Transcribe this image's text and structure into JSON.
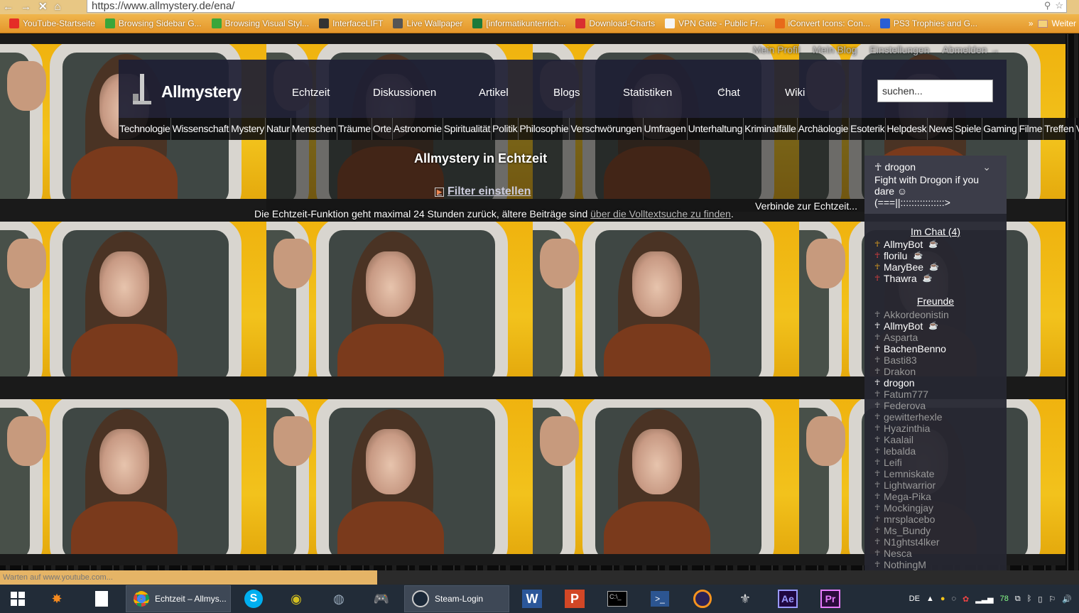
{
  "browser": {
    "url": "https://www.allmystery.de/ena/",
    "bookmarks": [
      {
        "label": "YouTube-Startseite",
        "icon": "youtube-icon",
        "color": "#e52d27"
      },
      {
        "label": "Browsing Sidebar G...",
        "icon": "leaf-icon",
        "color": "#3aa63a"
      },
      {
        "label": "Browsing Visual Styl...",
        "icon": "leaf-icon",
        "color": "#3aa63a"
      },
      {
        "label": "InterfaceLIFT",
        "icon": "ifl-icon",
        "color": "#333333"
      },
      {
        "label": "Live Wallpaper",
        "icon": "globe-icon",
        "color": "#555555"
      },
      {
        "label": "[informatikunterrich...",
        "icon": "iz-icon",
        "color": "#1c7a3a"
      },
      {
        "label": "Download-Charts",
        "icon": "chart-icon",
        "color": "#d93030"
      },
      {
        "label": "VPN Gate - Public Fr...",
        "icon": "page-icon",
        "color": "#f5f5f5"
      },
      {
        "label": "iConvert Icons: Con...",
        "icon": "convert-icon",
        "color": "#e86a1a"
      },
      {
        "label": "PS3 Trophies and G...",
        "icon": "ps3-icon",
        "color": "#2a5ed6"
      }
    ],
    "bookmarks_more": "»",
    "bookmarks_folder": "Weiter",
    "status": "Warten auf www.youtube.com..."
  },
  "site": {
    "top_links": [
      "Mein Profil",
      "Mein Blog",
      "Einstellungen",
      "Abmelden"
    ],
    "logout_arrow": "→",
    "logo": "Allmystery",
    "nav": [
      "Echtzeit",
      "Diskussionen",
      "Artikel",
      "Blogs",
      "Statistiken",
      "Chat",
      "Wiki"
    ],
    "chat_badge": "4",
    "search_placeholder": "suchen...",
    "categories": [
      "Technologie",
      "Wissenschaft",
      "Mystery",
      "Natur",
      "Menschen",
      "Träume",
      "Orte",
      "Astronomie",
      "Spiritualität",
      "Politik",
      "Philosophie",
      "Verschwörungen",
      "Umfragen",
      "Unterhaltung",
      "Kriminalfälle",
      "Archäologie",
      "Esoterik",
      "Helpdesk",
      "News",
      "Spiele",
      "Gaming",
      "Filme",
      "Treffen",
      "Verbesserungen"
    ]
  },
  "content": {
    "title": "Allmystery in Echtzeit",
    "filter": "Filter einstellen",
    "connecting": "Verbinde zur Echtzeit...",
    "info_text": "Die Echtzeit-Funktion geht maximal 24 Stunden zurück, ältere Beiträge sind ",
    "info_link": "über die Volltextsuche zu finden",
    "info_end": "."
  },
  "sidebar": {
    "user": "drogon",
    "status": "Fight with Drogon if you dare ☺ (===||::::::::::::::::>",
    "chat_heading": "Im Chat (4)",
    "chat_users": [
      {
        "name": "AllmyBot",
        "color": "#e0a020"
      },
      {
        "name": "florilu",
        "color": "#e04040"
      },
      {
        "name": "MaryBee",
        "color": "#e0a020"
      },
      {
        "name": "Thawra",
        "color": "#e04040"
      }
    ],
    "friends_heading": "Freunde",
    "friends": [
      {
        "name": "Akkordeonistin",
        "online": false,
        "cup": false
      },
      {
        "name": "AllmyBot",
        "online": true,
        "cup": true
      },
      {
        "name": "Asparta",
        "online": false,
        "cup": false
      },
      {
        "name": "BachenBenno",
        "online": true,
        "cup": false
      },
      {
        "name": "Basti83",
        "online": false,
        "cup": false
      },
      {
        "name": "Drakon",
        "online": false,
        "cup": false
      },
      {
        "name": "drogon",
        "online": true,
        "cup": false
      },
      {
        "name": "Fatum777",
        "online": false,
        "cup": false
      },
      {
        "name": "Federova",
        "online": false,
        "cup": false
      },
      {
        "name": "gewitterhexle",
        "online": false,
        "cup": false
      },
      {
        "name": "Hyazinthia",
        "online": false,
        "cup": false
      },
      {
        "name": "Kaalail",
        "online": false,
        "cup": false
      },
      {
        "name": "lebalda",
        "online": false,
        "cup": false
      },
      {
        "name": "Leifi",
        "online": false,
        "cup": false
      },
      {
        "name": "Lemniskate",
        "online": false,
        "cup": false
      },
      {
        "name": "Lightwarrior",
        "online": false,
        "cup": false
      },
      {
        "name": "Mega-Pika",
        "online": false,
        "cup": false
      },
      {
        "name": "Mockingjay",
        "online": false,
        "cup": false
      },
      {
        "name": "mrsplacebo",
        "online": false,
        "cup": false
      },
      {
        "name": "Ms_Bundy",
        "online": false,
        "cup": false
      },
      {
        "name": "N1ghtst4lker",
        "online": false,
        "cup": false
      },
      {
        "name": "Nesca",
        "online": false,
        "cup": false
      },
      {
        "name": "NothingM",
        "online": false,
        "cup": false
      }
    ]
  },
  "taskbar": {
    "chrome_window": "Echtzeit – Allmys...",
    "steam_window": "Steam-Login",
    "word": "W",
    "powerpoint": "P",
    "after_effects": "Ae",
    "premiere": "Pr",
    "language": "DE",
    "battery": "78"
  }
}
